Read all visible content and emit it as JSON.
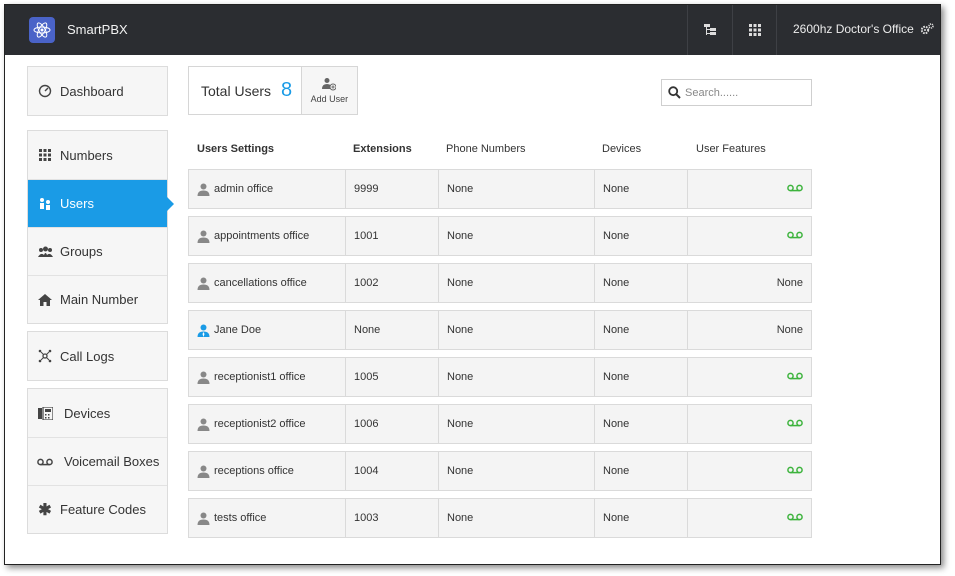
{
  "app": {
    "title": "SmartPBX",
    "account": "2600hz Doctor's Office"
  },
  "sidebar": {
    "groups": [
      [
        {
          "label": "Dashboard",
          "icon": "dashboard-icon"
        }
      ],
      [
        {
          "label": "Numbers",
          "icon": "grid-icon"
        },
        {
          "label": "Users",
          "icon": "users-icon",
          "active": true
        },
        {
          "label": "Groups",
          "icon": "group-icon"
        },
        {
          "label": "Main Number",
          "icon": "home-icon"
        }
      ],
      [
        {
          "label": "Call Logs",
          "icon": "call-logs-icon"
        }
      ],
      [
        {
          "label": "Devices",
          "icon": "devices-icon"
        },
        {
          "label": "Voicemail Boxes",
          "icon": "voicemail-icon"
        },
        {
          "label": "Feature Codes",
          "icon": "asterisk-icon"
        }
      ]
    ]
  },
  "summary": {
    "total_label": "Total Users",
    "total_count": "8",
    "add_user_label": "Add User"
  },
  "search": {
    "placeholder": "Search......"
  },
  "table": {
    "headers": [
      "Users Settings",
      "Extensions",
      "Phone Numbers",
      "Devices",
      "User Features"
    ],
    "rows": [
      {
        "name": "admin office",
        "extension": "9999",
        "phone": "None",
        "devices": "None",
        "features": "voicemail"
      },
      {
        "name": "appointments office",
        "extension": "1001",
        "phone": "None",
        "devices": "None",
        "features": "voicemail"
      },
      {
        "name": "cancellations office",
        "extension": "1002",
        "phone": "None",
        "devices": "None",
        "features": "None"
      },
      {
        "name": "Jane Doe",
        "extension": "None",
        "phone": "None",
        "devices": "None",
        "features": "None",
        "admin": true
      },
      {
        "name": "receptionist1 office",
        "extension": "1005",
        "phone": "None",
        "devices": "None",
        "features": "voicemail"
      },
      {
        "name": "receptionist2 office",
        "extension": "1006",
        "phone": "None",
        "devices": "None",
        "features": "voicemail"
      },
      {
        "name": "receptions office",
        "extension": "1004",
        "phone": "None",
        "devices": "None",
        "features": "voicemail"
      },
      {
        "name": "tests office",
        "extension": "1003",
        "phone": "None",
        "devices": "None",
        "features": "voicemail"
      }
    ]
  },
  "colors": {
    "accent": "#1a9be6",
    "topbar": "#2b2d31",
    "voicemail": "#3db33d",
    "admin_user": "#1a9be6"
  }
}
